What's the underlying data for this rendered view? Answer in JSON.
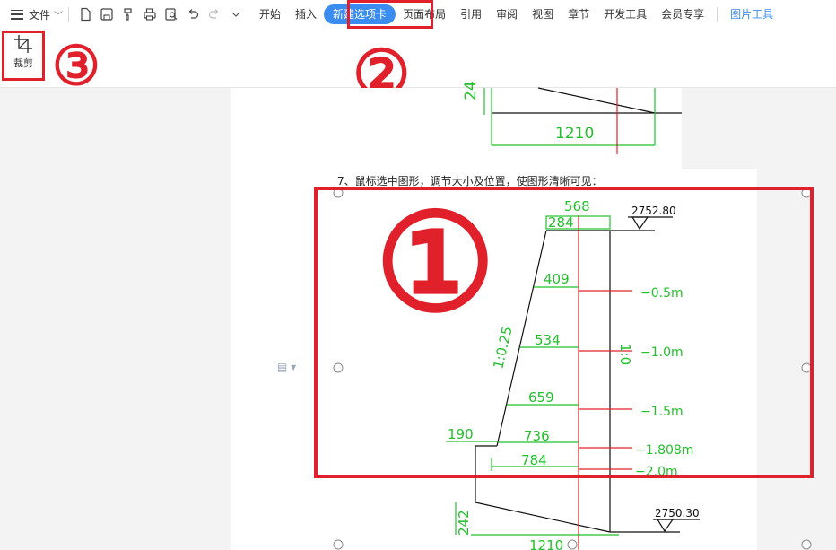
{
  "menubar": {
    "file_label": "文件",
    "tabs": [
      {
        "label": "开始"
      },
      {
        "label": "插入"
      },
      {
        "label": "新建选项卡"
      },
      {
        "label": "页面布局"
      },
      {
        "label": "引用"
      },
      {
        "label": "审阅"
      },
      {
        "label": "视图"
      },
      {
        "label": "章节"
      },
      {
        "label": "开发工具"
      },
      {
        "label": "会员专享"
      },
      {
        "label": "图片工具"
      }
    ],
    "active_tab": "新建选项卡"
  },
  "ribbon": {
    "crop_label": "裁剪"
  },
  "markers": {
    "one": "①",
    "two": "②",
    "three": "③"
  },
  "document": {
    "step_text": "7、鼠标选中图形，调节大小及位置，使图形清晰可见："
  },
  "upper_drawing": {
    "dim_side": "24",
    "dim_bottom": "1210"
  },
  "main_drawing": {
    "top_width": "568",
    "top_inner": "284",
    "elev_top": "2752.80",
    "elev_bottom": "2750.30",
    "slope_left": "1:0.25",
    "slope_right": "1:0",
    "widths": [
      "409",
      "534",
      "659",
      "736",
      "784"
    ],
    "depths": [
      "−0.5m",
      "−1.0m",
      "−1.5m",
      "−1.808m",
      "−2.0m"
    ],
    "base_offset": "190",
    "base_height": "242",
    "bottom_width": "1210"
  },
  "colors": {
    "accent": "#3b8cf0",
    "highlight": "#e0202a",
    "cad_green": "#22c02a",
    "cad_red": "#e0202a"
  }
}
